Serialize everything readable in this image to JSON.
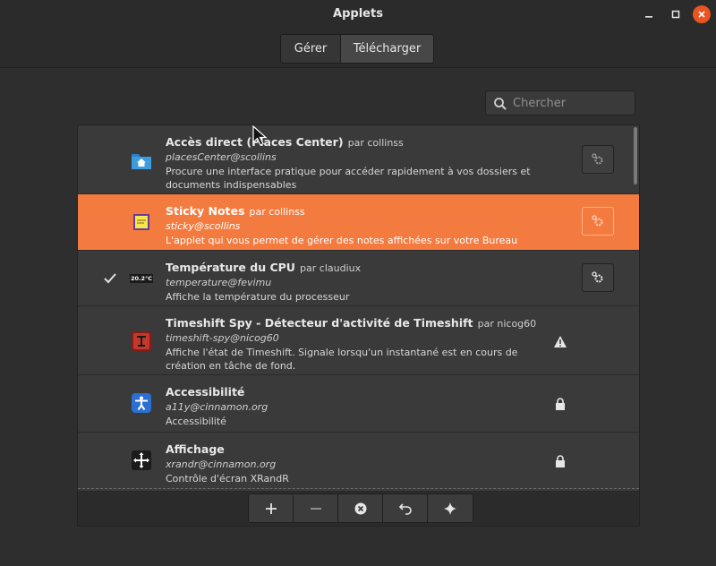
{
  "window": {
    "title": "Applets"
  },
  "tabs": {
    "manage": "Gérer",
    "download": "Télécharger"
  },
  "search": {
    "placeholder": "Chercher"
  },
  "applets": [
    {
      "name": "Accès direct (Places Center)",
      "author": "par collinss",
      "uuid": "placesCenter@scollins",
      "description": "Procure une interface pratique pour accéder rapidement à vos dossiers et documents indispensables",
      "icon": "folder-home-icon",
      "installed": false,
      "selected": false,
      "action": "configure"
    },
    {
      "name": "Sticky Notes",
      "author": "par collinss",
      "uuid": "sticky@scollins",
      "description": "L'applet qui vous permet de gérer des notes affichées sur votre Bureau",
      "icon": "sticky-note-icon",
      "installed": false,
      "selected": true,
      "action": "configure"
    },
    {
      "name": "Température du CPU",
      "author": "par claudiux",
      "uuid": "temperature@fevimu",
      "description": "Affiche la température du processeur",
      "icon": "temperature-icon",
      "icon_text": "20.2°C",
      "installed": true,
      "selected": false,
      "action": "configure"
    },
    {
      "name": "Timeshift Spy - Détecteur d'activité de Timeshift",
      "author": "par nicog60",
      "uuid": "timeshift-spy@nicog60",
      "description": "Affiche l'état de Timeshift. Signale lorsqu'un instantané est en cours de création en tâche de fond.",
      "icon": "timeshift-icon",
      "installed": false,
      "selected": false,
      "action": "warning"
    },
    {
      "name": "Accessibilité",
      "author": "",
      "uuid": "a11y@cinnamon.org",
      "description": "Accessibilité",
      "icon": "accessibility-icon",
      "installed": false,
      "selected": false,
      "action": "locked"
    },
    {
      "name": "Affichage",
      "author": "",
      "uuid": "xrandr@cinnamon.org",
      "description": "Contrôle d'écran XRandR",
      "icon": "display-icon",
      "installed": false,
      "selected": false,
      "action": "locked"
    }
  ],
  "toolbar_buttons": [
    "add-icon",
    "remove-icon",
    "uninstall-icon",
    "restore-icon",
    "more-applets-icon"
  ],
  "colors": {
    "accent": "#f47b3f",
    "close": "#e95420"
  }
}
